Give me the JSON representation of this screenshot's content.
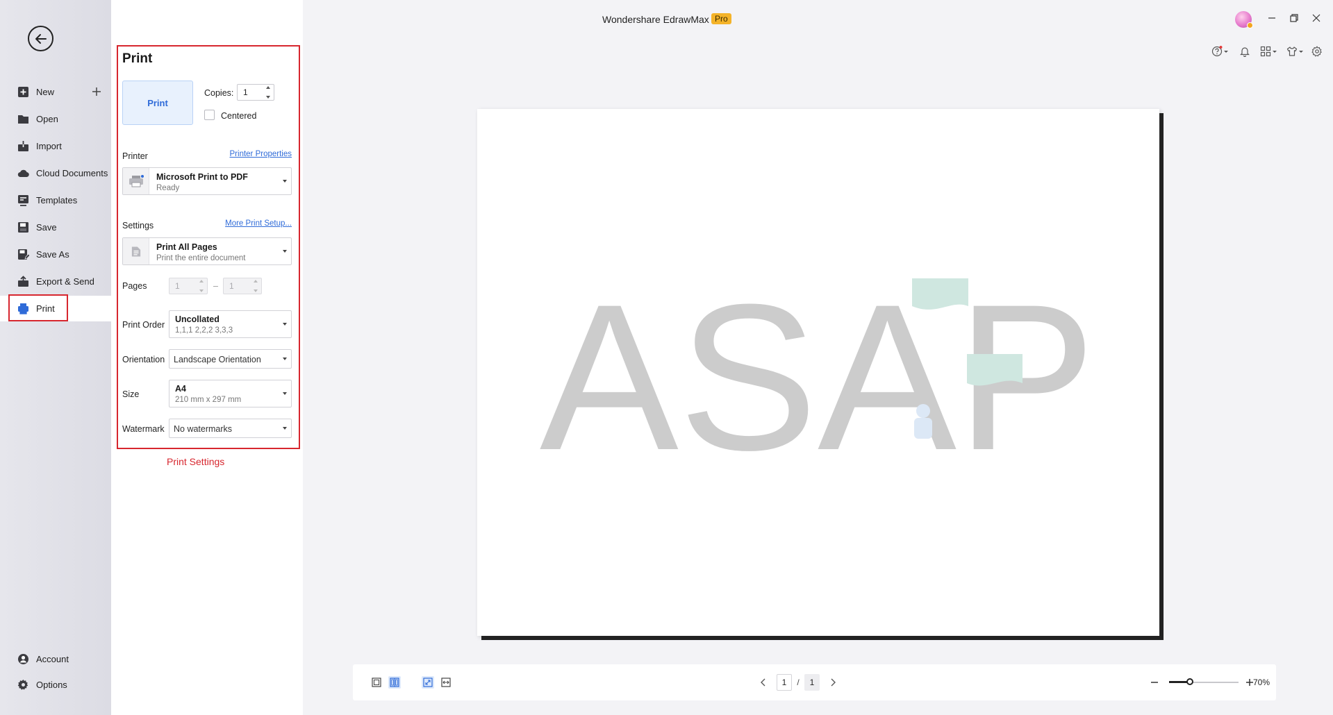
{
  "app": {
    "title": "Wondershare EdrawMax",
    "badge": "Pro"
  },
  "nav": {
    "items": [
      {
        "key": "new",
        "label": "New",
        "icon": "new-file-icon"
      },
      {
        "key": "open",
        "label": "Open",
        "icon": "folder-icon"
      },
      {
        "key": "import",
        "label": "Import",
        "icon": "import-icon"
      },
      {
        "key": "cloud",
        "label": "Cloud Documents",
        "icon": "cloud-icon"
      },
      {
        "key": "templates",
        "label": "Templates",
        "icon": "templates-icon"
      },
      {
        "key": "save",
        "label": "Save",
        "icon": "save-icon"
      },
      {
        "key": "saveas",
        "label": "Save As",
        "icon": "save-as-icon"
      },
      {
        "key": "export",
        "label": "Export & Send",
        "icon": "export-icon"
      },
      {
        "key": "print",
        "label": "Print",
        "icon": "printer-icon",
        "active": true
      }
    ],
    "bottom": [
      {
        "key": "account",
        "label": "Account",
        "icon": "account-icon"
      },
      {
        "key": "options",
        "label": "Options",
        "icon": "gear-icon"
      }
    ]
  },
  "print_panel": {
    "title": "Print",
    "print_button": "Print",
    "copies_label": "Copies:",
    "copies_value": "1",
    "centered_label": "Centered",
    "printer_section": "Printer",
    "printer_properties_link": "Printer Properties",
    "printer_name": "Microsoft Print to PDF",
    "printer_status": "Ready",
    "settings_section": "Settings",
    "more_setup_link": "More Print Setup...",
    "range_main": "Print All Pages",
    "range_sub": "Print the entire document",
    "pages_label": "Pages",
    "pages_from": "1",
    "pages_sep": "–",
    "pages_to": "1",
    "order_label": "Print Order",
    "order_main": "Uncollated",
    "order_sub": "1,1,1  2,2,2  3,3,3",
    "orientation_label": "Orientation",
    "orientation_value": "Landscape Orientation",
    "size_label": "Size",
    "size_main": "A4",
    "size_sub": "210 mm x 297 mm",
    "watermark_label": "Watermark",
    "watermark_value": "No watermarks",
    "annotation_caption": "Print Settings"
  },
  "preview": {
    "text": "ASAP",
    "text_color": "#cccccc",
    "accent_color": "#cfe7e0"
  },
  "bottom_bar": {
    "current_page": "1",
    "page_sep": "/",
    "total_pages": "1",
    "zoom_fraction": 0.3,
    "zoom_label": "70%"
  },
  "colors": {
    "accent": "#2f6bd8",
    "highlight_red": "#d7262e",
    "pro_badge": "#f4b329"
  }
}
